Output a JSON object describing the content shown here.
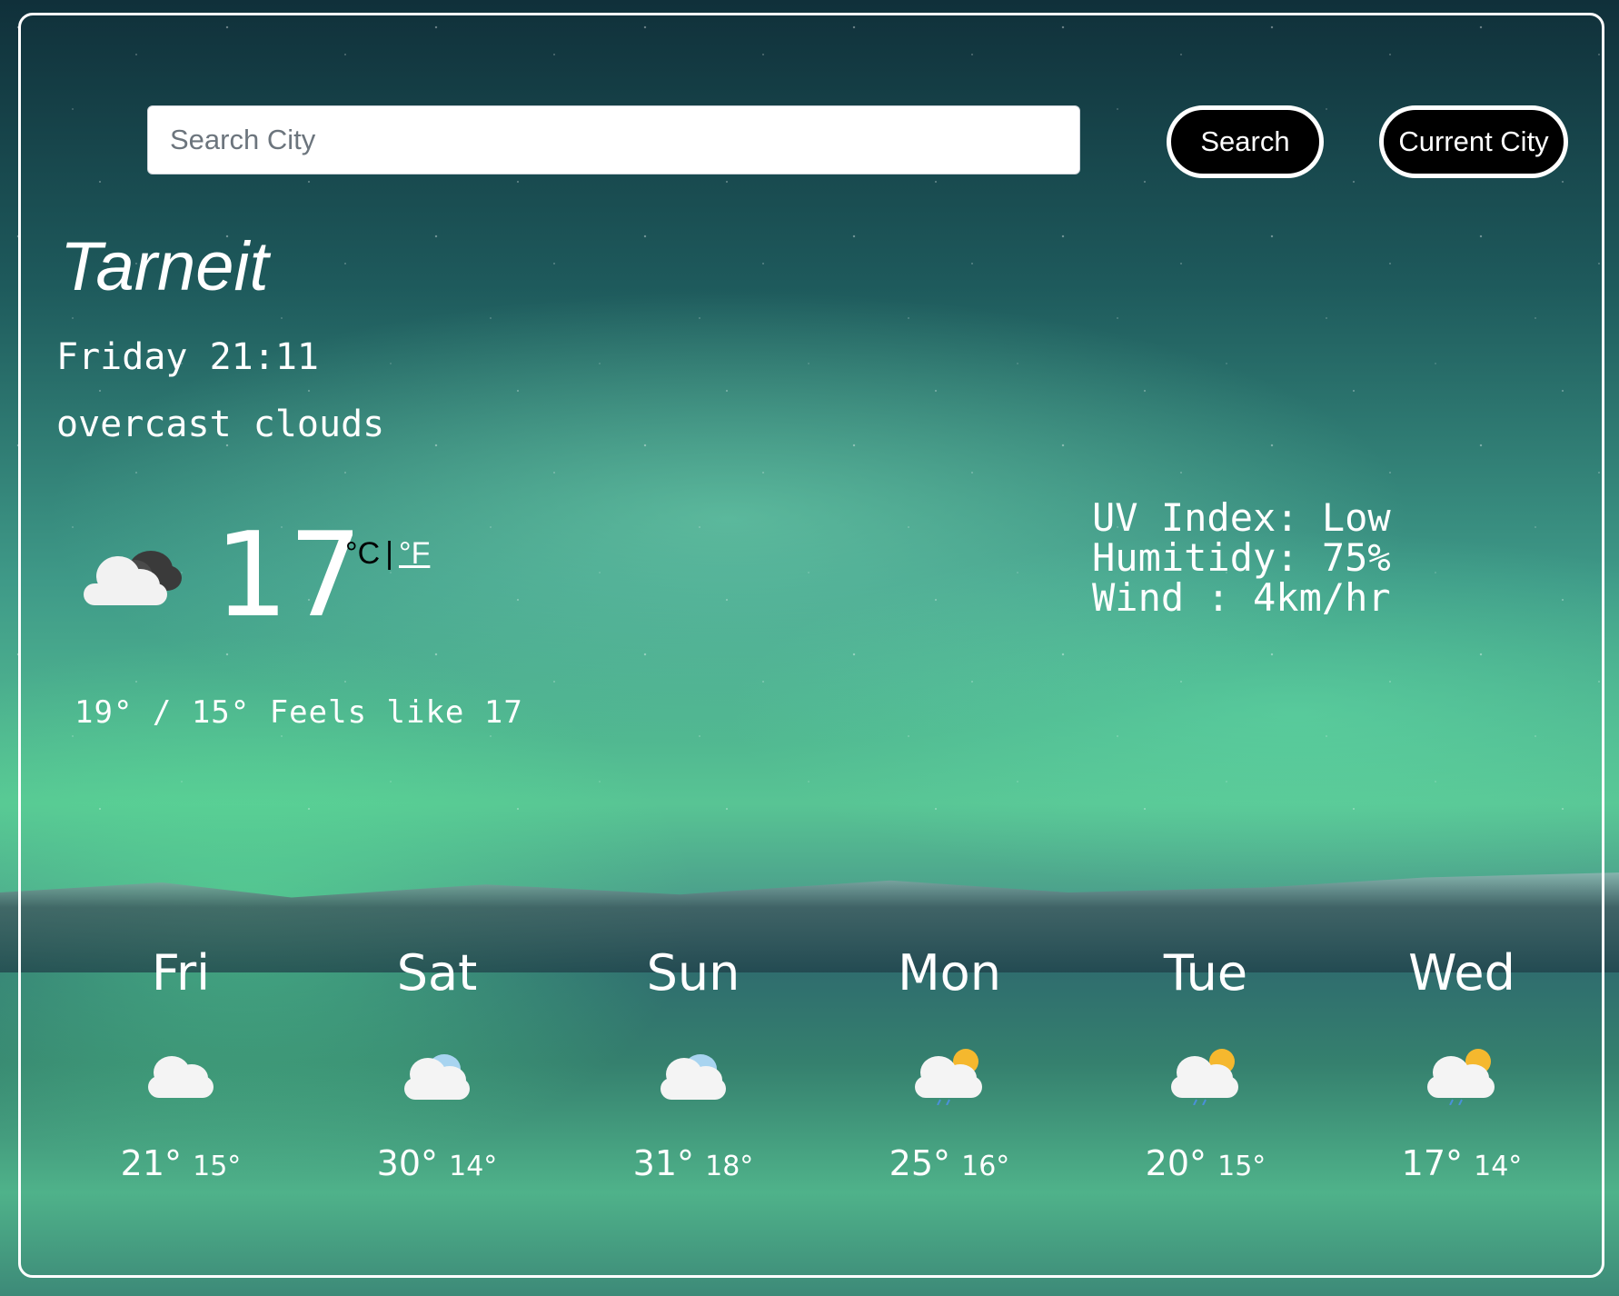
{
  "search": {
    "placeholder": "Search City",
    "search_label": "Search",
    "current_city_label": "Current City"
  },
  "current": {
    "city": "Tarneit",
    "datetime": "Friday 21:11",
    "description": "overcast clouds",
    "icon": "overcast-cloud-icon",
    "temperature": "17",
    "unit_c": "°C",
    "unit_sep": "|",
    "unit_f": "°F",
    "hi_lo_feels": "19° / 15° Feels like 17"
  },
  "details": {
    "uv": "UV Index: Low",
    "humidity": "Humitidy: 75%",
    "wind": "Wind : 4km/hr"
  },
  "forecast": [
    {
      "day": "Fri",
      "icon": "cloud-icon",
      "hi": "21°",
      "lo": "15°"
    },
    {
      "day": "Sat",
      "icon": "cloud-icon",
      "hi": "30°",
      "lo": "14°"
    },
    {
      "day": "Sun",
      "icon": "cloud-icon",
      "hi": "31°",
      "lo": "18°"
    },
    {
      "day": "Mon",
      "icon": "sun-cloud-rain-icon",
      "hi": "25°",
      "lo": "16°"
    },
    {
      "day": "Tue",
      "icon": "sun-cloud-rain-icon",
      "hi": "20°",
      "lo": "15°"
    },
    {
      "day": "Wed",
      "icon": "sun-cloud-rain-icon",
      "hi": "17°",
      "lo": "14°"
    }
  ],
  "colors": {
    "button_bg": "#000000",
    "button_border": "#ffffff",
    "text": "#ffffff"
  }
}
